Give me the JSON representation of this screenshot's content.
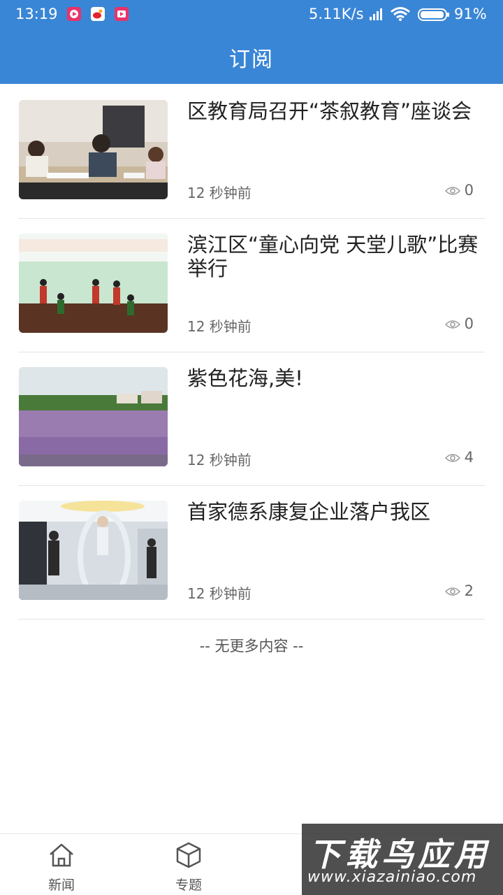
{
  "status_bar": {
    "time": "13:19",
    "network_speed": "5.11K/s",
    "battery": "91%",
    "notification_icons": [
      "video-app-icon",
      "weibo-icon",
      "video-app-icon"
    ]
  },
  "header": {
    "title": "订阅"
  },
  "news": [
    {
      "title": "区教育局召开“茶叙教育”座谈会",
      "time": "12 秒钟前",
      "views": "0",
      "thumbnail": "meeting-photo"
    },
    {
      "title": "滨江区“童心向党 天堂儿歌”比赛举行",
      "time": "12 秒钟前",
      "views": "0",
      "thumbnail": "children-performance-photo"
    },
    {
      "title": "紫色花海,美!",
      "time": "12 秒钟前",
      "views": "4",
      "thumbnail": "purple-flower-field-photo"
    },
    {
      "title": "首家德系康复企业落户我区",
      "time": "12 秒钟前",
      "views": "2",
      "thumbnail": "rehabilitation-equipment-photo"
    }
  ],
  "footer_text": "-- 无更多内容 --",
  "tab_bar": {
    "tabs": [
      {
        "label": "新闻",
        "icon": "home-icon"
      },
      {
        "label": "专题",
        "icon": "cube-icon"
      }
    ]
  },
  "watermark": {
    "title": "下载鸟应用",
    "url": "www.xiazainiao.com"
  },
  "colors": {
    "primary": "#3a86d6",
    "divider": "#e4e4e4",
    "text": "#222222",
    "muted": "#666666"
  }
}
